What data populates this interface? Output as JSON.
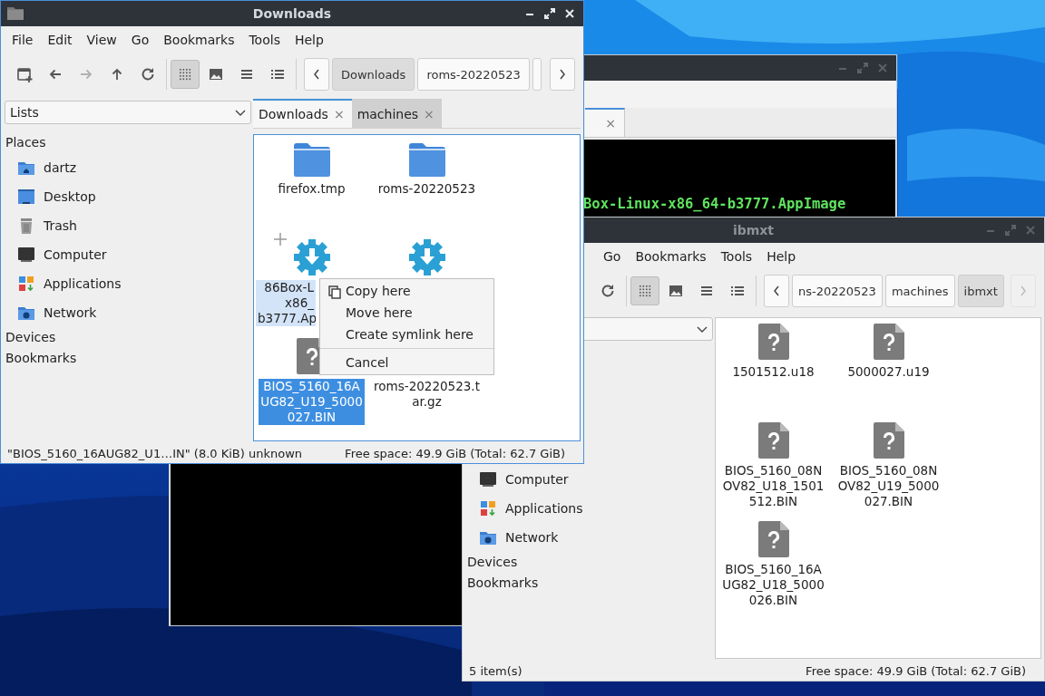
{
  "terminal_window": {
    "active": false,
    "tab": {
      "close": "×",
      "selected": true
    },
    "output_line": "Box-Linux-x86_64-b3777.AppImage"
  },
  "ibmxt_window": {
    "title": "ibmxt",
    "active": false,
    "menu": [
      "Go",
      "Bookmarks",
      "Tools",
      "Help"
    ],
    "toolbar": [
      {
        "kind": "reload",
        "disabled": false
      },
      {
        "kind": "separator"
      },
      {
        "kind": "icon-view",
        "selected": true
      },
      {
        "kind": "thumbnail-view",
        "selected": false
      },
      {
        "kind": "compact-view",
        "selected": false
      },
      {
        "kind": "detailed-view",
        "selected": false
      }
    ],
    "breadcrumb": {
      "items": [
        {
          "label": "ns-20220523",
          "selected": false
        },
        {
          "label": "machines",
          "selected": false
        },
        {
          "label": "ibmxt",
          "selected": true
        }
      ],
      "next_disabled": true
    },
    "sidebar": {
      "places": [
        {
          "label": "Computer",
          "kind": "computer"
        },
        {
          "label": "Applications",
          "kind": "applications"
        },
        {
          "label": "Network",
          "kind": "network"
        }
      ],
      "sections": [
        "Devices",
        "Bookmarks"
      ]
    },
    "files": [
      {
        "label_lines": [
          "1501512.u18"
        ],
        "kind": "file",
        "selected": false
      },
      {
        "label_lines": [
          "5000027.u19"
        ],
        "kind": "file",
        "selected": false
      },
      {
        "label_lines": [
          "BIOS_5160_08N",
          "OV82_U18_1501",
          "512.BIN"
        ],
        "kind": "file",
        "selected": false
      },
      {
        "label_lines": [
          "BIOS_5160_08N",
          "OV82_U19_5000",
          "027.BIN"
        ],
        "kind": "file",
        "selected": false
      },
      {
        "label_lines": [
          "BIOS_5160_16A",
          "UG82_U18_5000",
          "026.BIN"
        ],
        "kind": "file",
        "selected": false
      }
    ],
    "status_bar": {
      "left": "5 item(s)",
      "right": "Free space: 49.9 GiB (Total: 62.7 GiB)"
    }
  },
  "downloads_window": {
    "title": "Downloads",
    "active": true,
    "menu": [
      "File",
      "Edit",
      "View",
      "Go",
      "Bookmarks",
      "Tools",
      "Help"
    ],
    "toolbar": [
      {
        "kind": "new-tab",
        "disabled": false
      },
      {
        "kind": "back",
        "disabled": false
      },
      {
        "kind": "forward",
        "disabled": true
      },
      {
        "kind": "up",
        "disabled": false
      },
      {
        "kind": "reload",
        "disabled": false
      },
      {
        "kind": "separator"
      },
      {
        "kind": "icon-view",
        "selected": true
      },
      {
        "kind": "thumbnail-view",
        "selected": false
      },
      {
        "kind": "compact-view",
        "selected": false
      },
      {
        "kind": "detailed-view",
        "selected": false
      }
    ],
    "breadcrumb": {
      "items": [
        {
          "label": "Downloads",
          "selected": true
        },
        {
          "label": "roms-20220523",
          "selected": false
        },
        {
          "selected": false
        }
      ],
      "next_disabled": false
    },
    "sidebar": {
      "dropdown": "Lists",
      "heading": "Places",
      "places": [
        {
          "label": "dartz",
          "kind": "home"
        },
        {
          "label": "Desktop",
          "kind": "desktop"
        },
        {
          "label": "Trash",
          "kind": "trash"
        },
        {
          "label": "Computer",
          "kind": "computer"
        },
        {
          "label": "Applications",
          "kind": "applications"
        },
        {
          "label": "Network",
          "kind": "network"
        }
      ],
      "sections": [
        "Devices",
        "Bookmarks"
      ]
    },
    "tabs": [
      {
        "label": "Downloads",
        "close": "×",
        "selected": true
      },
      {
        "label": "machines",
        "close": "×",
        "selected": false
      }
    ],
    "files": [
      {
        "label_lines": [
          "firefox.tmp"
        ],
        "kind": "folder",
        "selected": false,
        "hovered": false
      },
      {
        "label_lines": [
          "roms-20220523"
        ],
        "kind": "folder",
        "selected": false,
        "hovered": false
      },
      {
        "label_lines": [
          "86Box-L",
          "x86_",
          "b3777.Ap"
        ],
        "kind": "app",
        "selected": false,
        "hovered": true,
        "drag_marker": true
      },
      {
        "kind": "app",
        "selected": false,
        "hovered": false
      },
      {
        "label_lines": [
          "BIOS_5160_16A",
          "UG82_U19_5000",
          "027.BIN"
        ],
        "kind": "file",
        "selected": true,
        "hovered": false
      },
      {
        "label_lines": [
          "roms-20220523.t",
          "ar.gz"
        ],
        "selected": false,
        "hovered": false
      }
    ],
    "context_menu": {
      "items": [
        {
          "label": "Copy here",
          "kind": "copy"
        },
        {
          "label": "Move here",
          "kind": "plain"
        },
        {
          "label": "Create symlink here",
          "kind": "plain"
        },
        {
          "kind": "separator"
        },
        {
          "label": "Cancel",
          "kind": "plain"
        }
      ]
    },
    "status_bar": {
      "left": "\"BIOS_5160_16AUG82_U1…IN\" (8.0 KiB) unknown",
      "right": "Free space: 49.9 GiB (Total: 62.7 GiB)"
    }
  }
}
